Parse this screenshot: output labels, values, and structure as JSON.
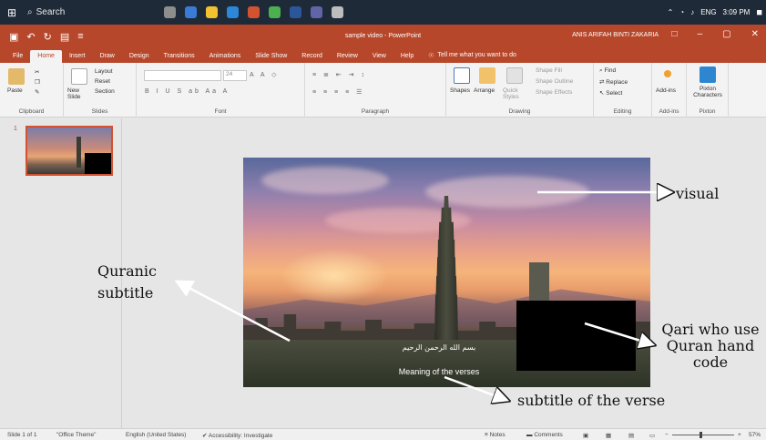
{
  "taskbar": {
    "search_label": "Search",
    "tray": {
      "lang": "ENG",
      "time": "3:09 PM"
    }
  },
  "titlebar": {
    "title": "sample video - PowerPoint",
    "user": "ANIS ARIFAH BINTI ZAKARIA"
  },
  "tabs": [
    "File",
    "Home",
    "Insert",
    "Draw",
    "Design",
    "Transitions",
    "Animations",
    "Slide Show",
    "Record",
    "Review",
    "View",
    "Help"
  ],
  "active_tab": "Home",
  "tell_me": "Tell me what you want to do",
  "ribbon": {
    "clipboard": {
      "paste": "Paste",
      "label": "Clipboard"
    },
    "slides": {
      "new_slide": "New Slide",
      "layout": "Layout",
      "reset": "Reset",
      "section": "Section",
      "label": "Slides"
    },
    "font": {
      "size": "24",
      "label": "Font"
    },
    "paragraph": {
      "label": "Paragraph"
    },
    "drawing": {
      "shapes": "Shapes",
      "arrange": "Arrange",
      "quick_styles": "Quick Styles",
      "shape_fill": "Shape Fill",
      "shape_outline": "Shape Outline",
      "shape_effects": "Shape Effects",
      "label": "Drawing"
    },
    "editing": {
      "find": "Find",
      "replace": "Replace",
      "select": "Select",
      "label": "Editing"
    },
    "addins": {
      "addins": "Add-ins",
      "label": "Add-ins"
    },
    "pixton": {
      "characters": "Pixton Characters",
      "label": "Pixton"
    }
  },
  "thumbnails": {
    "number": "1"
  },
  "slide": {
    "arabic_subtitle": "بسم الله الرحمن الرحيم",
    "meaning": "Meaning of the verses"
  },
  "annotations": {
    "visual": "visual",
    "quranic_1": "Quranic",
    "quranic_2": "subtitle",
    "qari_1": "Qari who use",
    "qari_2": "Quran hand",
    "qari_3": "code",
    "verse_subtitle": "subtitle of the verse"
  },
  "statusbar": {
    "slide_info": "Slide 1 of 1",
    "theme": "\"Office Theme\"",
    "language": "English (United States)",
    "accessibility": "Accessibility: Investigate",
    "notes": "Notes",
    "comments": "Comments",
    "zoom": "57%"
  },
  "colors": {
    "accent": "#b7472a",
    "taskbar": "#1e2a38"
  }
}
